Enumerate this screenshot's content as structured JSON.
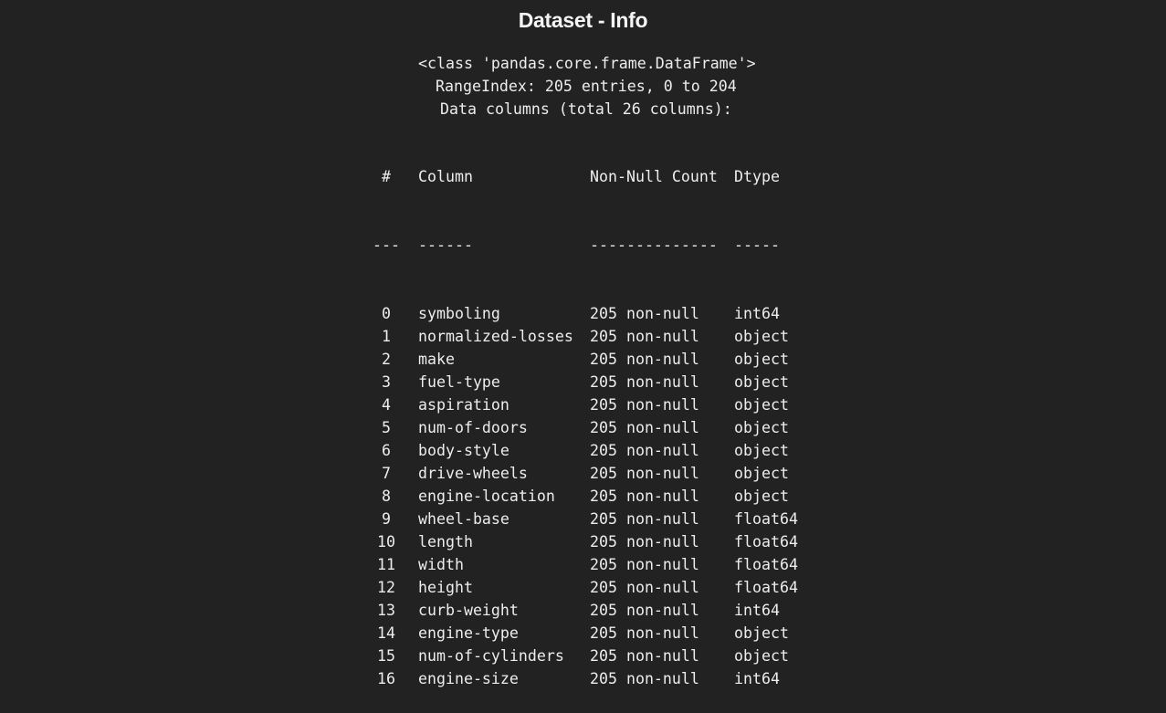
{
  "title": "Dataset - Info",
  "info": {
    "class_line": "<class 'pandas.core.frame.DataFrame'>",
    "range_line": "RangeIndex: 205 entries, 0 to 204",
    "columns_line": "Data columns (total 26 columns):"
  },
  "table": {
    "headers": {
      "num": "#",
      "column": "Column",
      "non_null": "Non-Null Count",
      "dtype": "Dtype"
    },
    "separators": {
      "num": "---",
      "column": "------",
      "non_null": "--------------",
      "dtype": "-----"
    },
    "rows": [
      {
        "num": "0",
        "column": "symboling",
        "non_null": "205 non-null",
        "dtype": "int64"
      },
      {
        "num": "1",
        "column": "normalized-losses",
        "non_null": "205 non-null",
        "dtype": "object"
      },
      {
        "num": "2",
        "column": "make",
        "non_null": "205 non-null",
        "dtype": "object"
      },
      {
        "num": "3",
        "column": "fuel-type",
        "non_null": "205 non-null",
        "dtype": "object"
      },
      {
        "num": "4",
        "column": "aspiration",
        "non_null": "205 non-null",
        "dtype": "object"
      },
      {
        "num": "5",
        "column": "num-of-doors",
        "non_null": "205 non-null",
        "dtype": "object"
      },
      {
        "num": "6",
        "column": "body-style",
        "non_null": "205 non-null",
        "dtype": "object"
      },
      {
        "num": "7",
        "column": "drive-wheels",
        "non_null": "205 non-null",
        "dtype": "object"
      },
      {
        "num": "8",
        "column": "engine-location",
        "non_null": "205 non-null",
        "dtype": "object"
      },
      {
        "num": "9",
        "column": "wheel-base",
        "non_null": "205 non-null",
        "dtype": "float64"
      },
      {
        "num": "10",
        "column": "length",
        "non_null": "205 non-null",
        "dtype": "float64"
      },
      {
        "num": "11",
        "column": "width",
        "non_null": "205 non-null",
        "dtype": "float64"
      },
      {
        "num": "12",
        "column": "height",
        "non_null": "205 non-null",
        "dtype": "float64"
      },
      {
        "num": "13",
        "column": "curb-weight",
        "non_null": "205 non-null",
        "dtype": "int64"
      },
      {
        "num": "14",
        "column": "engine-type",
        "non_null": "205 non-null",
        "dtype": "object"
      },
      {
        "num": "15",
        "column": "num-of-cylinders",
        "non_null": "205 non-null",
        "dtype": "object"
      },
      {
        "num": "16",
        "column": "engine-size",
        "non_null": "205 non-null",
        "dtype": "int64"
      }
    ]
  },
  "colors": {
    "background": "#222222",
    "text": "#ededed"
  }
}
